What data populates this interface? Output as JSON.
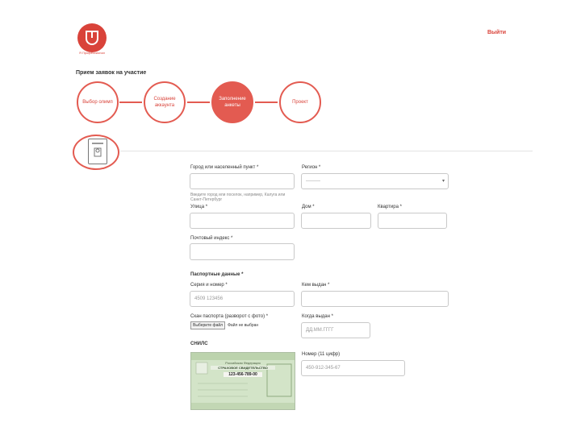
{
  "header": {
    "logo_text": "Я Профессионал",
    "logout_label": "Выйти"
  },
  "page": {
    "heading": "Прием заявок на участие"
  },
  "steps": [
    {
      "label": "Выбор олимп",
      "active": false
    },
    {
      "label": "Создание аккаунта",
      "active": false
    },
    {
      "label": "Заполнение анкеты",
      "active": true
    },
    {
      "label": "Проект",
      "active": false
    }
  ],
  "form": {
    "city_label": "Город или населенный пункт *",
    "city_value": "",
    "city_hint": "Введите город или поселок, например, Калуга или Санкт-Петербург",
    "region_label": "Регион *",
    "region_value": "———",
    "street_label": "Улица *",
    "street_value": "",
    "house_label": "Дом *",
    "house_value": "",
    "apartment_label": "Квартира *",
    "apartment_value": "",
    "postal_label": "Почтовый индекс *",
    "postal_value": "",
    "passport_section": "Паспортные данные *",
    "series_label": "Серия и номер *",
    "series_placeholder": "4509 123456",
    "issued_by_label": "Кем выдан *",
    "issued_by_value": "",
    "scan_label": "Скан паспорта (разворот с фото) *",
    "scan_button": "Выберите файл",
    "scan_status": "Файл не выбран",
    "issue_date_label": "Когда выдан *",
    "issue_date_placeholder": "ДД.ММ.ГГГГ",
    "snils_section": "СНИЛС",
    "snils_number_label": "Номер (11 цифр)",
    "snils_number_placeholder": "450-912-345-67"
  },
  "snils_card": {
    "line1": "Российская Федерация",
    "line2": "СТРАХОВОЕ СВИДЕТЕЛЬСТВО",
    "number": "123-456-789-00"
  },
  "colors": {
    "accent": "#e35b51",
    "logo": "#d9433a",
    "card_green": "#cfe1c4"
  },
  "icons": {
    "logo": "brand-logo-icon",
    "document": "passport-document-icon"
  }
}
